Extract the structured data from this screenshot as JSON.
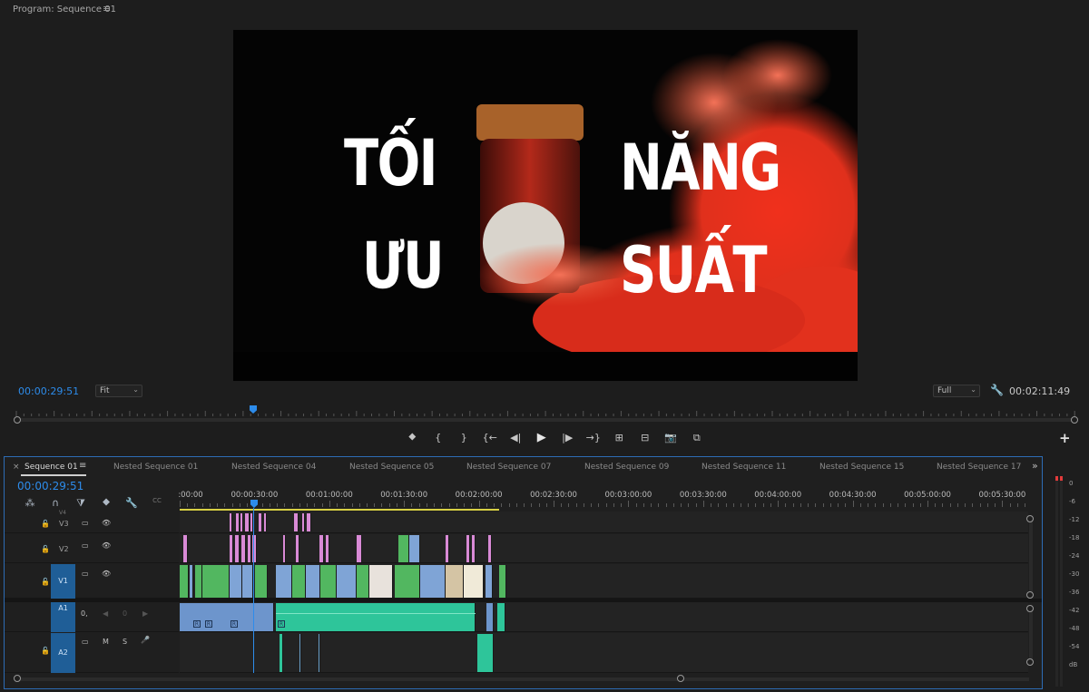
{
  "monitor": {
    "title": "Program: Sequence 01",
    "menu_icon": "≡",
    "thumbnail_text": {
      "line1_left": "TỐI",
      "line2_left": "ƯU",
      "line1_right": "NĂNG",
      "line2_right": "SUẤT"
    },
    "current_timecode": "00:00:29:51",
    "zoom": "Fit",
    "quality": "Full",
    "duration_timecode": "00:02:11:49",
    "transport": [
      "add-marker-icon",
      "mark-in-icon",
      "mark-out-icon",
      "go-to-in-icon",
      "step-back-icon",
      "play-icon",
      "step-forward-icon",
      "go-to-out-icon",
      "insert-icon",
      "overwrite-icon",
      "export-frame-icon",
      "compare-icon"
    ],
    "transport_glyphs": [
      "⯁",
      "{",
      "}",
      "{←",
      "◀|",
      "▶",
      "|▶",
      "→}",
      "⊞",
      "⊟",
      "📷",
      "⧉"
    ],
    "add_glyph": "+"
  },
  "timeline": {
    "tabs": [
      "Sequence 01",
      "Nested Sequence 01",
      "Nested Sequence 04",
      "Nested Sequence 05",
      "Nested Sequence 07",
      "Nested Sequence 09",
      "Nested Sequence 11",
      "Nested Sequence 15",
      "Nested Sequence 17"
    ],
    "active_tab": "Sequence 01",
    "close_glyph": "×",
    "overflow_glyph": "»",
    "timecode": "00:00:29:51",
    "tools": [
      "nest-icon",
      "snap-icon",
      "linked-selection-icon",
      "add-marker-icon",
      "settings-icon",
      "captions-icon"
    ],
    "tool_glyphs": [
      "⁂",
      "∩",
      "⧩",
      "⯁",
      "🔧",
      "CC"
    ],
    "ruler_labels": [
      ":00:00",
      "00:00:30:00",
      "00:01:00:00",
      "00:01:30:00",
      "00:02:00:00",
      "00:02:30:00",
      "00:03:00:00",
      "00:03:30:00",
      "00:04:00:00",
      "00:04:30:00",
      "00:05:00:00",
      "00:05:30:00"
    ],
    "tracks": {
      "v4": "V4",
      "v3": "V3",
      "v2": "V2",
      "v1": "V1",
      "a1": "A1",
      "a2": "A2",
      "eye_glyph": "👁",
      "camera_glyph": "▭",
      "lock_glyph": "🔓",
      "a1_toggles": [
        "0,",
        "◀",
        "0",
        "▶"
      ],
      "a2_toggles": [
        "M",
        "S",
        "🎤"
      ],
      "fx_badge": "R"
    }
  },
  "meter": {
    "db_labels": [
      "0",
      "-6",
      "-12",
      "-18",
      "-24",
      "-30",
      "-36",
      "-42",
      "-48",
      "-54",
      "dB"
    ]
  },
  "colors": {
    "accent_blue": "#2d8ceb",
    "clip_pink": "#d98ad6",
    "clip_blue": "#7fa4d6",
    "clip_green": "#52b760",
    "audio_green": "#2ec59a",
    "smoke_red": "#e2311d"
  }
}
